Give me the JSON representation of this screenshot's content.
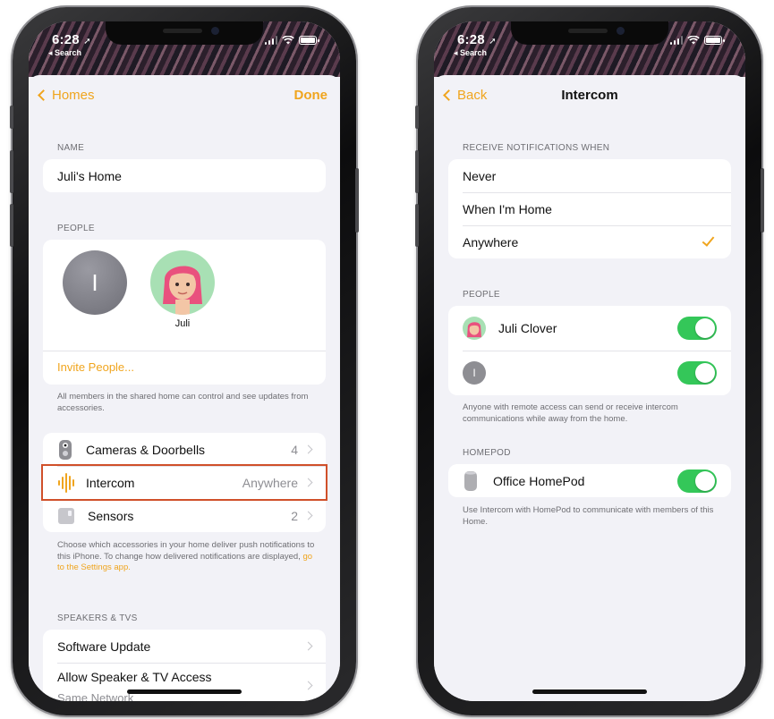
{
  "status_bar": {
    "time": "6:28",
    "back_label": "◂ Search"
  },
  "left_screen": {
    "nav": {
      "back_label": "Homes",
      "done_label": "Done"
    },
    "name_section": {
      "label": "NAME",
      "value": "Juli's Home"
    },
    "people_section": {
      "label": "PEOPLE",
      "members": [
        {
          "initial": "I",
          "name": ""
        },
        {
          "name": "Juli"
        }
      ],
      "invite_label": "Invite People...",
      "footnote": "All members in the shared home can control and see updates from accessories."
    },
    "notifications": {
      "rows": [
        {
          "label": "Cameras & Doorbells",
          "value": "4"
        },
        {
          "label": "Intercom",
          "value": "Anywhere"
        },
        {
          "label": "Sensors",
          "value": "2"
        }
      ],
      "footnote_text": "Choose which accessories in your home deliver push notifications to this iPhone. To change how delivered notifications are displayed, ",
      "footnote_link": "go to the Settings app."
    },
    "speakers_section": {
      "label": "SPEAKERS & TVS",
      "rows": [
        {
          "label": "Software Update"
        },
        {
          "label": "Allow Speaker & TV Access",
          "sublabel": "Same Network"
        }
      ]
    }
  },
  "right_screen": {
    "nav": {
      "back_label": "Back",
      "title": "Intercom"
    },
    "receive_section": {
      "label": "RECEIVE NOTIFICATIONS WHEN",
      "options": [
        "Never",
        "When I'm Home",
        "Anywhere"
      ],
      "selected": "Anywhere"
    },
    "people_section": {
      "label": "PEOPLE",
      "people": [
        {
          "name": "Juli Clover",
          "enabled": true
        },
        {
          "name": "",
          "initial": "I",
          "enabled": true
        }
      ],
      "footnote": "Anyone with remote access can send or receive intercom communications while away from the home."
    },
    "homepod_section": {
      "label": "HOMEPOD",
      "devices": [
        {
          "name": "Office HomePod",
          "enabled": true
        }
      ],
      "footnote": "Use Intercom with HomePod to communicate with members of this Home."
    }
  },
  "colors": {
    "accent": "#f0a51e",
    "toggle_on": "#34c759",
    "highlight_border": "#d0502a",
    "background": "#f2f2f7"
  }
}
